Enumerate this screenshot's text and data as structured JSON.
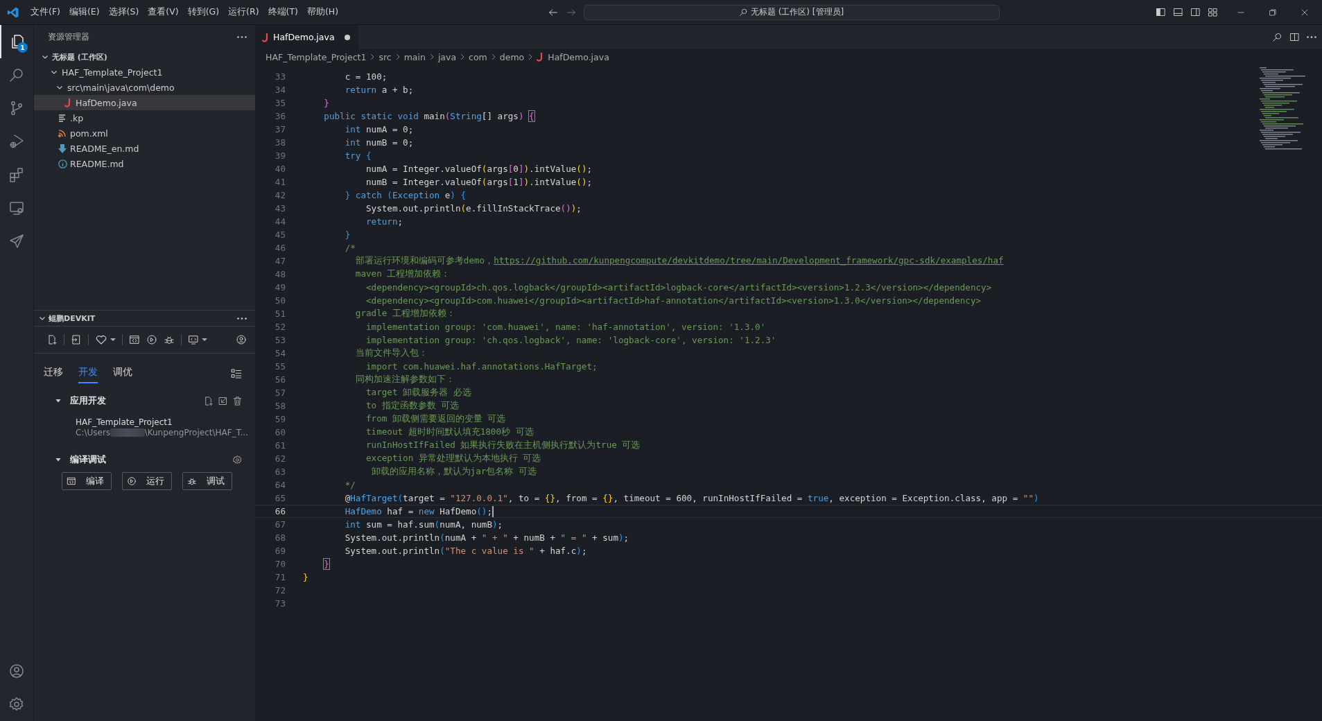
{
  "title_bar": {
    "menu": [
      "文件(F)",
      "编辑(E)",
      "选择(S)",
      "查看(V)",
      "转到(G)",
      "运行(R)",
      "终端(T)",
      "帮助(H)"
    ],
    "search": "无标题 (工作区) [管理员]"
  },
  "activity_bar": {
    "items": [
      {
        "kind": "explorer",
        "selected": true,
        "badge": "1"
      },
      {
        "kind": "search",
        "selected": false
      },
      {
        "kind": "source-control",
        "selected": false
      },
      {
        "kind": "run-debug",
        "selected": false
      },
      {
        "kind": "extensions",
        "selected": false
      },
      {
        "kind": "remote",
        "selected": false
      },
      {
        "kind": "kunpeng",
        "selected": false
      }
    ],
    "bottom": [
      {
        "kind": "account"
      },
      {
        "kind": "settings"
      }
    ]
  },
  "explorer": {
    "title": "资源管理器",
    "workspace": {
      "label": "无标题 (工作区)",
      "expanded": true
    },
    "tree": [
      {
        "kind": "folder",
        "label": "HAF_Template_Project1",
        "expanded": true,
        "selected": false,
        "children": [
          {
            "kind": "folder",
            "label": "src\\main\\java\\com\\demo",
            "expanded": true,
            "selected": false,
            "children": [
              {
                "kind": "java",
                "label": "HafDemo.java",
                "selected": true
              }
            ]
          },
          {
            "kind": "text",
            "label": ".kp",
            "selected": false
          },
          {
            "kind": "xml",
            "label": "pom.xml",
            "selected": false
          },
          {
            "kind": "markdown",
            "label": "README_en.md",
            "selected": false
          },
          {
            "kind": "info",
            "label": "README.md",
            "selected": false
          }
        ]
      }
    ]
  },
  "devkit": {
    "title": "鲲鹏DEVKIT",
    "expanded": true,
    "tabs": [
      {
        "label": "迁移",
        "selected": false
      },
      {
        "label": "开发",
        "selected": true
      },
      {
        "label": "调优",
        "selected": false
      }
    ],
    "app_dev": {
      "title": "应用开发",
      "expanded": true,
      "project": {
        "name": "HAF_Template_Project1",
        "path_start": "C:\\Users",
        "path_end": "\\KunpengProject\\HAF_T..."
      }
    },
    "build_debug": {
      "title": "编译调试",
      "expanded": true,
      "buttons": [
        {
          "kind": "build",
          "label": "编译"
        },
        {
          "kind": "run",
          "label": "运行"
        },
        {
          "kind": "debug",
          "label": "调试"
        }
      ]
    }
  },
  "editor": {
    "tabs": [
      {
        "label": "HafDemo.java",
        "selected": true,
        "modified": true
      }
    ],
    "breadcrumbs": [
      {
        "kind": "folder",
        "label": "HAF_Template_Project1"
      },
      {
        "kind": "folder",
        "label": "src"
      },
      {
        "kind": "folder",
        "label": "main"
      },
      {
        "kind": "folder",
        "label": "java"
      },
      {
        "kind": "folder",
        "label": "com"
      },
      {
        "kind": "folder",
        "label": "demo"
      },
      {
        "kind": "java",
        "label": "HafDemo.java"
      }
    ],
    "lines": [
      {
        "number": "33",
        "current": false,
        "tokens": [
          {
            "kind": "plain",
            "text": "        c = 100;"
          }
        ]
      },
      {
        "number": "34",
        "current": false,
        "tokens": [
          {
            "kind": "keyword",
            "text": "        return"
          },
          {
            "kind": "plain",
            "text": " a + b;"
          }
        ]
      },
      {
        "number": "35",
        "current": false,
        "tokens": [
          {
            "kind": "brace2",
            "text": "    }"
          }
        ]
      },
      {
        "number": "36",
        "current": false,
        "tokens": [
          {
            "kind": "keyword",
            "text": "    public static void"
          },
          {
            "kind": "plain",
            "text": " main"
          },
          {
            "kind": "brace2",
            "text": "("
          },
          {
            "kind": "type",
            "text": "String"
          },
          {
            "kind": "plain",
            "text": "[] args"
          },
          {
            "kind": "brace2",
            "text": ") "
          },
          {
            "kind": "match",
            "text": "{"
          }
        ]
      },
      {
        "number": "37",
        "current": false,
        "tokens": [
          {
            "kind": "keyword",
            "text": "        int"
          },
          {
            "kind": "plain",
            "text": " numA = 0;"
          }
        ]
      },
      {
        "number": "38",
        "current": false,
        "tokens": [
          {
            "kind": "keyword",
            "text": "        int"
          },
          {
            "kind": "plain",
            "text": " numB = 0;"
          }
        ]
      },
      {
        "number": "39",
        "current": false,
        "tokens": [
          {
            "kind": "keyword",
            "text": "        try "
          },
          {
            "kind": "brace3",
            "text": "{"
          }
        ]
      },
      {
        "number": "40",
        "current": false,
        "tokens": [
          {
            "kind": "plain",
            "text": "            numA = Integer.valueOf"
          },
          {
            "kind": "brace1",
            "text": "("
          },
          {
            "kind": "plain",
            "text": "args"
          },
          {
            "kind": "brace2",
            "text": "["
          },
          {
            "kind": "plain",
            "text": "0"
          },
          {
            "kind": "brace2",
            "text": "]"
          },
          {
            "kind": "brace1",
            "text": ")"
          },
          {
            "kind": "plain",
            "text": ".intValue"
          },
          {
            "kind": "brace1",
            "text": "()"
          },
          {
            "kind": "plain",
            "text": ";"
          }
        ]
      },
      {
        "number": "41",
        "current": false,
        "tokens": [
          {
            "kind": "plain",
            "text": "            numB = Integer.valueOf"
          },
          {
            "kind": "brace1",
            "text": "("
          },
          {
            "kind": "plain",
            "text": "args"
          },
          {
            "kind": "brace2",
            "text": "["
          },
          {
            "kind": "plain",
            "text": "1"
          },
          {
            "kind": "brace2",
            "text": "]"
          },
          {
            "kind": "brace1",
            "text": ")"
          },
          {
            "kind": "plain",
            "text": ".intValue"
          },
          {
            "kind": "brace1",
            "text": "()"
          },
          {
            "kind": "plain",
            "text": ";"
          }
        ]
      },
      {
        "number": "42",
        "current": false,
        "tokens": [
          {
            "kind": "brace3",
            "text": "        } "
          },
          {
            "kind": "keyword",
            "text": "catch "
          },
          {
            "kind": "brace3",
            "text": "("
          },
          {
            "kind": "type",
            "text": "Exception"
          },
          {
            "kind": "plain",
            "text": " e"
          },
          {
            "kind": "brace3",
            "text": ") {"
          }
        ]
      },
      {
        "number": "43",
        "current": false,
        "tokens": [
          {
            "kind": "plain",
            "text": "            System.out.println"
          },
          {
            "kind": "brace1",
            "text": "("
          },
          {
            "kind": "plain",
            "text": "e.fillInStackTrace"
          },
          {
            "kind": "brace2",
            "text": "()"
          },
          {
            "kind": "brace1",
            "text": ")"
          },
          {
            "kind": "plain",
            "text": ";"
          }
        ]
      },
      {
        "number": "44",
        "current": false,
        "tokens": [
          {
            "kind": "keyword",
            "text": "            return"
          },
          {
            "kind": "plain",
            "text": ";"
          }
        ]
      },
      {
        "number": "45",
        "current": false,
        "tokens": [
          {
            "kind": "brace3",
            "text": "        }"
          }
        ]
      },
      {
        "number": "46",
        "current": false,
        "tokens": [
          {
            "kind": "comment",
            "text": "        /*"
          }
        ]
      },
      {
        "number": "47",
        "current": false,
        "tokens": [
          {
            "kind": "comment",
            "text": "          部署运行环境和编码可参考demo，"
          },
          {
            "kind": "link",
            "text": "https://github.com/kunpengcompute/devkitdemo/tree/main/Development_framework/gpc-sdk/examples/haf"
          }
        ]
      },
      {
        "number": "48",
        "current": false,
        "tokens": [
          {
            "kind": "comment",
            "text": "          maven 工程增加依赖："
          }
        ]
      },
      {
        "number": "49",
        "current": false,
        "tokens": [
          {
            "kind": "comment",
            "text": "            <dependency><groupId>ch.qos.logback</groupId><artifactId>logback-core</artifactId><version>1.2.3</version></dependency>"
          }
        ]
      },
      {
        "number": "50",
        "current": false,
        "tokens": [
          {
            "kind": "comment",
            "text": "            <dependency><groupId>com.huawei</groupId><artifactId>haf-annotation</artifactId><version>1.3.0</version></dependency>"
          }
        ]
      },
      {
        "number": "51",
        "current": false,
        "tokens": [
          {
            "kind": "comment",
            "text": "          gradle 工程增加依赖："
          }
        ]
      },
      {
        "number": "52",
        "current": false,
        "tokens": [
          {
            "kind": "comment",
            "text": "            implementation group: 'com.huawei', name: 'haf-annotation', version: '1.3.0'"
          }
        ]
      },
      {
        "number": "53",
        "current": false,
        "tokens": [
          {
            "kind": "comment",
            "text": "            implementation group: 'ch.qos.logback', name: 'logback-core', version: '1.2.3'"
          }
        ]
      },
      {
        "number": "54",
        "current": false,
        "tokens": [
          {
            "kind": "comment",
            "text": "          当前文件导入包："
          }
        ]
      },
      {
        "number": "55",
        "current": false,
        "tokens": [
          {
            "kind": "comment",
            "text": "            import com.huawei.haf.annotations.HafTarget;"
          }
        ]
      },
      {
        "number": "56",
        "current": false,
        "tokens": [
          {
            "kind": "comment",
            "text": "          同构加速注解参数如下："
          }
        ]
      },
      {
        "number": "57",
        "current": false,
        "tokens": [
          {
            "kind": "comment",
            "text": "            target 卸载服务器 必选"
          }
        ]
      },
      {
        "number": "58",
        "current": false,
        "tokens": [
          {
            "kind": "comment",
            "text": "            to 指定函数参数 可选"
          }
        ]
      },
      {
        "number": "59",
        "current": false,
        "tokens": [
          {
            "kind": "comment",
            "text": "            from 卸载侧需要返回的变量 可选"
          }
        ]
      },
      {
        "number": "60",
        "current": false,
        "tokens": [
          {
            "kind": "comment",
            "text": "            timeout 超时时间默认填充1800秒 可选"
          }
        ]
      },
      {
        "number": "61",
        "current": false,
        "tokens": [
          {
            "kind": "comment",
            "text": "            runInHostIfFailed 如果执行失败在主机侧执行默认为true 可选"
          }
        ]
      },
      {
        "number": "62",
        "current": false,
        "tokens": [
          {
            "kind": "comment",
            "text": "            exception 异常处理默认为本地执行 可选"
          }
        ]
      },
      {
        "number": "63",
        "current": false,
        "tokens": [
          {
            "kind": "comment",
            "text": "             卸载的应用名称，默认为jar包名称 可选"
          }
        ]
      },
      {
        "number": "64",
        "current": false,
        "tokens": [
          {
            "kind": "comment",
            "text": "        */"
          }
        ]
      },
      {
        "number": "65",
        "current": false,
        "tokens": [
          {
            "kind": "plain",
            "text": "        @"
          },
          {
            "kind": "type",
            "text": "HafTarget"
          },
          {
            "kind": "brace3",
            "text": "("
          },
          {
            "kind": "plain",
            "text": "target = "
          },
          {
            "kind": "string",
            "text": "\"127.0.0.1\""
          },
          {
            "kind": "plain",
            "text": ", to = "
          },
          {
            "kind": "brace1",
            "text": "{}"
          },
          {
            "kind": "plain",
            "text": ", from = "
          },
          {
            "kind": "brace1",
            "text": "{}"
          },
          {
            "kind": "plain",
            "text": ", timeout = 600, runInHostIfFailed = "
          },
          {
            "kind": "keyword",
            "text": "true"
          },
          {
            "kind": "plain",
            "text": ", exception = Exception.class, app = "
          },
          {
            "kind": "string",
            "text": "\"\""
          },
          {
            "kind": "brace3",
            "text": ")"
          }
        ]
      },
      {
        "number": "66",
        "current": true,
        "tokens": [
          {
            "kind": "type",
            "text": "        HafDemo"
          },
          {
            "kind": "plain",
            "text": " haf = "
          },
          {
            "kind": "keyword",
            "text": "new"
          },
          {
            "kind": "plain",
            "text": " HafDemo"
          },
          {
            "kind": "brace3",
            "text": "()"
          },
          {
            "kind": "plain",
            "text": ";"
          }
        ]
      },
      {
        "number": "67",
        "current": false,
        "tokens": [
          {
            "kind": "keyword",
            "text": "        int"
          },
          {
            "kind": "plain",
            "text": " sum = haf.sum"
          },
          {
            "kind": "brace3",
            "text": "("
          },
          {
            "kind": "plain",
            "text": "numA, numB"
          },
          {
            "kind": "brace3",
            "text": ")"
          },
          {
            "kind": "plain",
            "text": ";"
          }
        ]
      },
      {
        "number": "68",
        "current": false,
        "tokens": [
          {
            "kind": "plain",
            "text": "        System.out.println"
          },
          {
            "kind": "brace3",
            "text": "("
          },
          {
            "kind": "plain",
            "text": "numA + "
          },
          {
            "kind": "string",
            "text": "\" + \""
          },
          {
            "kind": "plain",
            "text": " + numB + "
          },
          {
            "kind": "string",
            "text": "\" = \""
          },
          {
            "kind": "plain",
            "text": " + sum"
          },
          {
            "kind": "brace3",
            "text": ")"
          },
          {
            "kind": "plain",
            "text": ";"
          }
        ]
      },
      {
        "number": "69",
        "current": false,
        "tokens": [
          {
            "kind": "plain",
            "text": "        System.out.println"
          },
          {
            "kind": "brace3",
            "text": "("
          },
          {
            "kind": "string",
            "text": "\"The c value is \""
          },
          {
            "kind": "plain",
            "text": " + haf.c"
          },
          {
            "kind": "brace3",
            "text": ")"
          },
          {
            "kind": "plain",
            "text": ";"
          }
        ]
      },
      {
        "number": "70",
        "current": false,
        "tokens": [
          {
            "kind": "match",
            "text": "    }"
          }
        ]
      },
      {
        "number": "71",
        "current": false,
        "tokens": [
          {
            "kind": "brace1",
            "text": "}"
          }
        ]
      },
      {
        "number": "72",
        "current": false
      },
      {
        "number": "73",
        "current": false
      }
    ]
  }
}
